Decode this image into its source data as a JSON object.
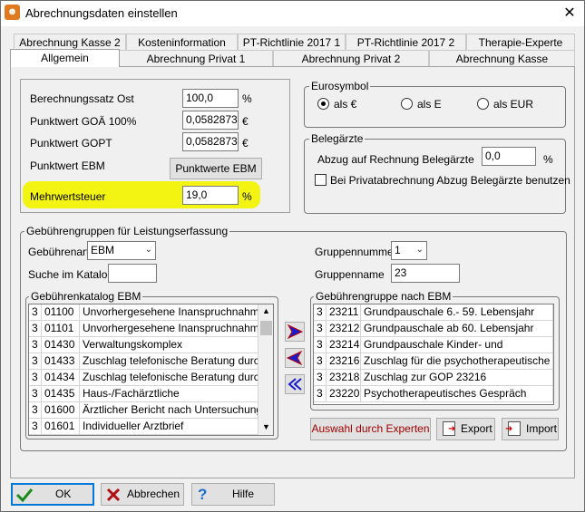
{
  "window": {
    "title": "Abrechnungsdaten einstellen",
    "close_glyph": "✕"
  },
  "tabs_row1": [
    "Abrechnung Kasse 2",
    "Kosteninformation",
    "PT-Richtlinie 2017 1",
    "PT-Richtlinie 2017 2",
    "Therapie-Experte"
  ],
  "tabs_row2": [
    "Allgemein",
    "Abrechnung Privat 1",
    "Abrechnung Privat 2",
    "Abrechnung Kasse"
  ],
  "settings": {
    "berechnungssatz_label": "Berechnungssatz Ost",
    "berechnungssatz_value": "100,0",
    "berechnungssatz_unit": "%",
    "punktwert_goa_label": "Punktwert GOÄ 100%",
    "punktwert_goa_value": "0,0582873",
    "punktwert_goa_unit": "€",
    "punktwert_gopt_label": "Punktwert GOPT",
    "punktwert_gopt_value": "0,0582873",
    "punktwert_gopt_unit": "€",
    "punktwert_ebm_label": "Punktwert EBM",
    "punktwerte_ebm_button": "Punktwerte EBM",
    "mwst_label": "Mehrwertsteuer",
    "mwst_value": "19,0",
    "mwst_unit": "%"
  },
  "eurosymbol": {
    "legend": "Eurosymbol",
    "options": [
      "als €",
      "als E",
      "als EUR"
    ],
    "selected": "als €"
  },
  "belegaerzte": {
    "legend": "Belegärzte",
    "abzug_label": "Abzug auf Rechnung Belegärzte",
    "abzug_value": "0,0",
    "abzug_unit": "%",
    "checkbox_label": "Bei Privatabrechnung Abzug Belegärzte benutzen"
  },
  "gebuehren": {
    "legend": "Gebührengruppen für Leistungserfassung",
    "gebuehrenart_label": "Gebührenart",
    "gebuehrenart_value": "EBM",
    "suche_label": "Suche im Katalog",
    "suche_value": "",
    "gruppennummer_label": "Gruppennummer",
    "gruppennummer_value": "1",
    "gruppenname_label": "Gruppenname",
    "gruppenname_value": "23",
    "katalog_legend": "Gebührenkatalog EBM",
    "katalog_rows": [
      [
        "3",
        "01100",
        "Unvorhergesehene Inanspruchnahme I"
      ],
      [
        "3",
        "01101",
        "Unvorhergesehene Inanspruchnahme II"
      ],
      [
        "3",
        "01430",
        "Verwaltungskomplex"
      ],
      [
        "3",
        "01433",
        "Zuschlag telefonische Beratung durch"
      ],
      [
        "3",
        "01434",
        "Zuschlag telefonische Beratung durch"
      ],
      [
        "3",
        "01435",
        "Haus-/Fachärztliche"
      ],
      [
        "3",
        "01600",
        "Ärztlicher Bericht nach Untersuchung"
      ],
      [
        "3",
        "01601",
        "Individueller Arztbrief"
      ]
    ],
    "gruppe_legend": "Gebührengruppe nach EBM",
    "gruppe_rows": [
      [
        "3",
        "23211",
        "Grundpauschale 6.- 59. Lebensjahr"
      ],
      [
        "3",
        "23212",
        "Grundpauschale ab 60. Lebensjahr"
      ],
      [
        "3",
        "23214",
        "Grundpauschale Kinder- und"
      ],
      [
        "3",
        "23216",
        "Zuschlag für die psychotherapeutische"
      ],
      [
        "3",
        "23218",
        "Zuschlag zur GOP 23216"
      ],
      [
        "3",
        "23220",
        "Psychotherapeutisches Gespräch"
      ]
    ],
    "auswahl_button": "Auswahl durch Experten",
    "export_button": "Export",
    "import_button": "Import"
  },
  "footer": {
    "ok": "OK",
    "abbrechen": "Abbrechen",
    "hilfe": "Hilfe"
  },
  "colors": {
    "highlight": "#f4f412",
    "arrow_blue": "#1a1acc",
    "auswahl_text": "#a00000"
  }
}
